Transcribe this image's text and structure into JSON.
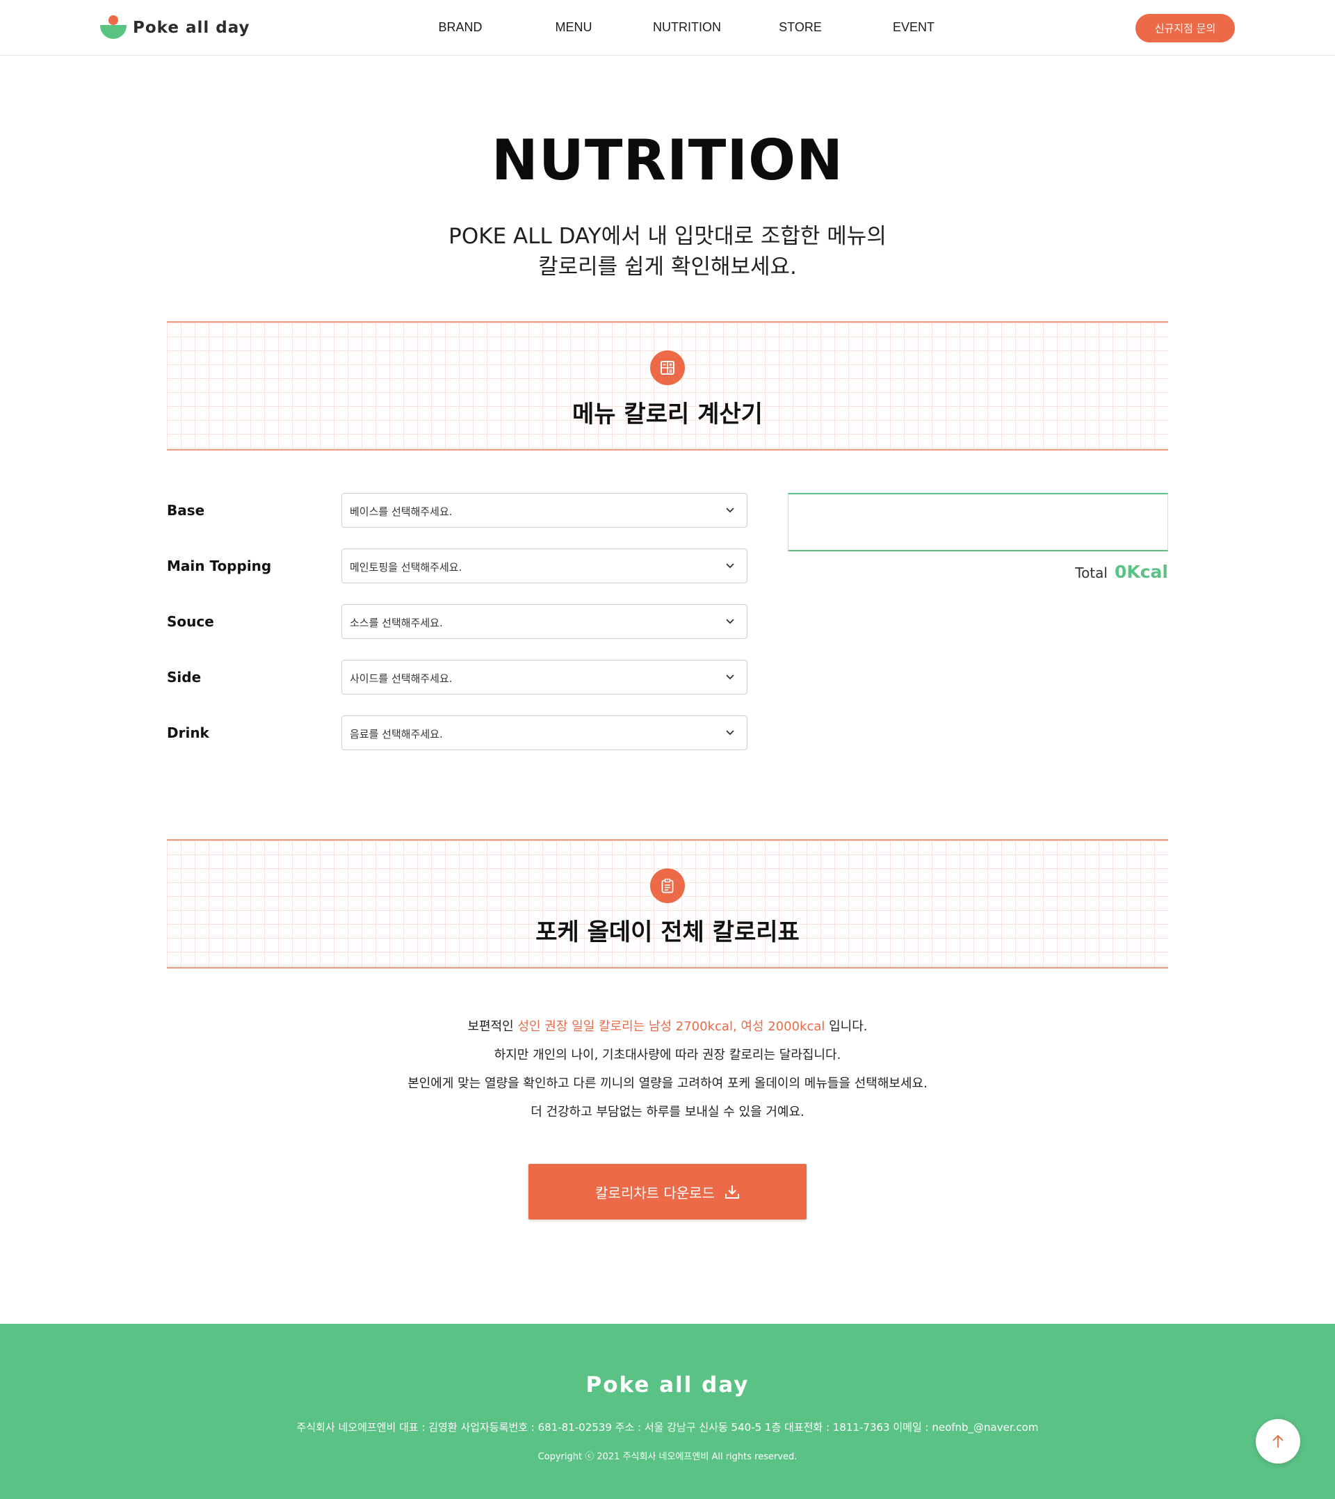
{
  "header": {
    "logo_text": "Poke all day",
    "nav": [
      {
        "label": "BRAND"
      },
      {
        "label": "MENU"
      },
      {
        "label": "NUTRITION"
      },
      {
        "label": "STORE"
      },
      {
        "label": "EVENT"
      }
    ],
    "cta_label": "신규지점 문의"
  },
  "hero": {
    "title": "NUTRITION",
    "intro_line1": "POKE ALL DAY에서 내 입맛대로 조합한 메뉴의",
    "intro_line2": "칼로리를 쉽게 확인해보세요."
  },
  "calculator": {
    "title": "메뉴 칼로리 계산기",
    "icon": "calculator-icon",
    "fields": [
      {
        "label": "Base",
        "placeholder": "베이스를 선택해주세요."
      },
      {
        "label": "Main Topping",
        "placeholder": "메인토핑을 선택해주세요."
      },
      {
        "label": "Souce",
        "placeholder": "소스를 선택해주세요."
      },
      {
        "label": "Side",
        "placeholder": "사이드를 선택해주세요."
      },
      {
        "label": "Drink",
        "placeholder": "음료를 선택해주세요."
      }
    ],
    "total_label": "Total",
    "total_value": "0Kcal"
  },
  "calorie_chart": {
    "title": "포케 올데이 전체 칼로리표",
    "icon": "clipboard-icon",
    "line1_pre": "보편적인 ",
    "line1_highlight": "성인 권장 일일 칼로리는 남성 2700kcal, 여성 2000kcal",
    "line1_post": " 입니다.",
    "line2": "하지만 개인의 나이, 기초대사량에 따라 권장 칼로리는 달라집니다.",
    "line3": "본인에게 맞는 열량을 확인하고 다른 끼니의 열량을 고려하여 포케 올데이의 메뉴들을 선택해보세요.",
    "line4": "더 건강하고 부담없는 하루를 보내실 수 있을 거예요.",
    "download_label": "칼로리차트 다운로드"
  },
  "footer": {
    "logo_text": "Poke all day",
    "company_info": "주식회사 네오에프엔비 대표 : 김영환 사업자등록번호 : 681-81-02539 주소 : 서울 강남구 신사동 540-5 1층 대표전화 : 1811-7363 이메일 : neofnb_@naver.com",
    "copyright": "Copyright ⓒ 2021 주식회사 네오에프엔비 All rights reserved."
  },
  "colors": {
    "accent": "#ec6a47",
    "green": "#5bc285"
  }
}
